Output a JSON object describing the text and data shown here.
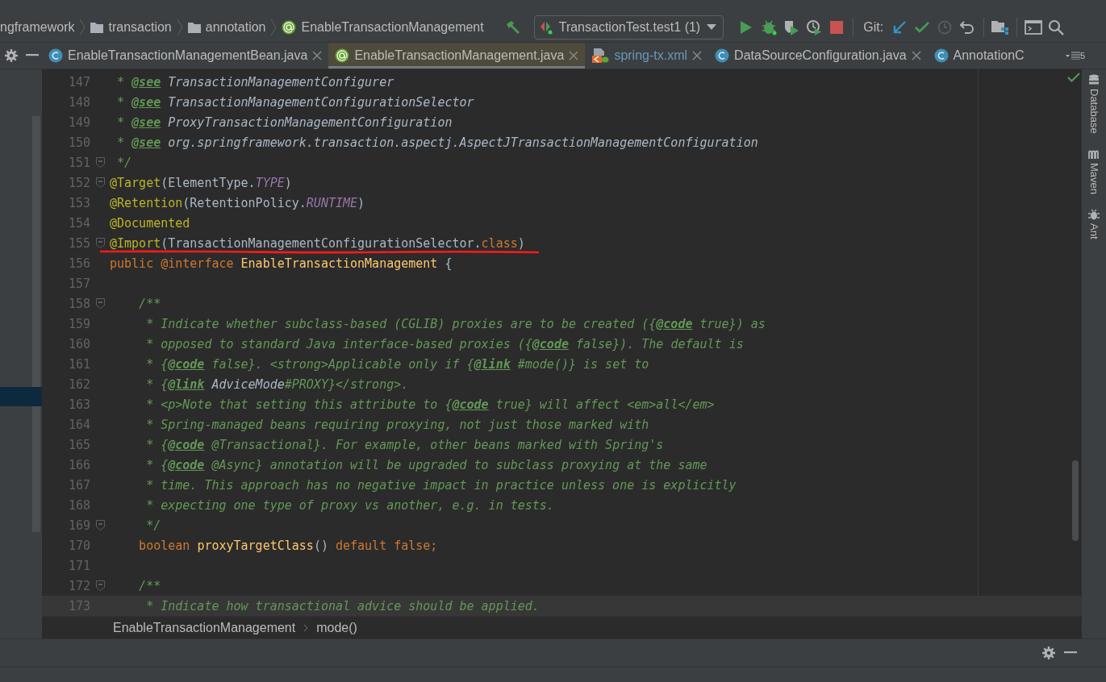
{
  "navbar": {
    "breadcrumbs": [
      {
        "label": "ngframework",
        "kind": "plain"
      },
      {
        "label": "transaction",
        "kind": "folder"
      },
      {
        "label": "annotation",
        "kind": "folder"
      },
      {
        "label": "EnableTransactionManagement",
        "kind": "annotation"
      }
    ],
    "run_config": "TransactionTest.test1 (1)",
    "git_label": "Git:"
  },
  "tabs": [
    {
      "label": "EnableTransactionManagementBean.java",
      "kind": "class",
      "selected": false,
      "closable": true
    },
    {
      "label": "EnableTransactionManagement.java",
      "kind": "annotation",
      "selected": true,
      "closable": true
    },
    {
      "label": "spring-tx.xml",
      "kind": "xml",
      "selected": false,
      "closable": true
    },
    {
      "label": "DataSourceConfiguration.java",
      "kind": "class",
      "selected": false,
      "closable": true
    },
    {
      "label": "AnnotationC",
      "kind": "class",
      "selected": false,
      "closable": false
    }
  ],
  "tab_overflow": "5",
  "side_tools": [
    "Database",
    "Maven",
    "Ant"
  ],
  "editor": {
    "lines": [
      {
        "n": "147",
        "fold": false,
        "current": false,
        "segments": [
          {
            "t": " * ",
            "kind": "doc"
          },
          {
            "t": "@see",
            "kind": "doctag"
          },
          {
            "t": " TransactionManagementConfigurer",
            "kind": "docref"
          }
        ]
      },
      {
        "n": "148",
        "fold": false,
        "current": false,
        "segments": [
          {
            "t": " * ",
            "kind": "doc"
          },
          {
            "t": "@see",
            "kind": "doctag"
          },
          {
            "t": " TransactionManagementConfigurationSelector",
            "kind": "docref"
          }
        ]
      },
      {
        "n": "149",
        "fold": false,
        "current": false,
        "segments": [
          {
            "t": " * ",
            "kind": "doc"
          },
          {
            "t": "@see",
            "kind": "doctag"
          },
          {
            "t": " ProxyTransactionManagementConfiguration",
            "kind": "docref"
          }
        ]
      },
      {
        "n": "150",
        "fold": false,
        "current": false,
        "segments": [
          {
            "t": " * ",
            "kind": "doc"
          },
          {
            "t": "@see",
            "kind": "doctag"
          },
          {
            "t": " org.springframework.transaction.aspectj.AspectJTransactionManagementConfiguration",
            "kind": "docref"
          }
        ]
      },
      {
        "n": "151",
        "fold": true,
        "current": false,
        "segments": [
          {
            "t": " */",
            "kind": "doc"
          }
        ]
      },
      {
        "n": "152",
        "fold": true,
        "current": false,
        "segments": [
          {
            "t": "@Target",
            "kind": "annotation"
          },
          {
            "t": "(ElementType.",
            "kind": "plain"
          },
          {
            "t": "TYPE",
            "kind": "const"
          },
          {
            "t": ")",
            "kind": "plain"
          }
        ]
      },
      {
        "n": "153",
        "fold": false,
        "current": false,
        "segments": [
          {
            "t": "@Retention",
            "kind": "annotation"
          },
          {
            "t": "(RetentionPolicy.",
            "kind": "plain"
          },
          {
            "t": "RUNTIME",
            "kind": "const"
          },
          {
            "t": ")",
            "kind": "plain"
          }
        ]
      },
      {
        "n": "154",
        "fold": false,
        "current": false,
        "segments": [
          {
            "t": "@Documented",
            "kind": "annotation"
          }
        ]
      },
      {
        "n": "155",
        "fold": true,
        "current": false,
        "marked": true,
        "segments": [
          {
            "t": "@Import",
            "kind": "annotation"
          },
          {
            "t": "(TransactionManagementConfigurationSelector.",
            "kind": "plain"
          },
          {
            "t": "class",
            "kind": "keyword"
          },
          {
            "t": ")",
            "kind": "plain"
          }
        ]
      },
      {
        "n": "156",
        "fold": false,
        "current": false,
        "segments": [
          {
            "t": "public @interface ",
            "kind": "keyword"
          },
          {
            "t": "EnableTransactionManagement",
            "kind": "method"
          },
          {
            "t": " {",
            "kind": "plain"
          }
        ]
      },
      {
        "n": "157",
        "fold": false,
        "current": false
      },
      {
        "n": "158",
        "fold": true,
        "current": false,
        "segments": [
          {
            "t": "    /**",
            "kind": "doc"
          }
        ]
      },
      {
        "n": "159",
        "fold": false,
        "current": false,
        "segments": [
          {
            "t": "     * Indicate whether subclass-based (CGLIB) proxies are to be created ({",
            "kind": "doc"
          },
          {
            "t": "@code",
            "kind": "doctag"
          },
          {
            "t": " true}) as",
            "kind": "doc"
          }
        ]
      },
      {
        "n": "160",
        "fold": false,
        "current": false,
        "segments": [
          {
            "t": "     * opposed to standard Java interface-based proxies ({",
            "kind": "doc"
          },
          {
            "t": "@code",
            "kind": "doctag"
          },
          {
            "t": " false}). The default is",
            "kind": "doc"
          }
        ]
      },
      {
        "n": "161",
        "fold": false,
        "current": false,
        "segments": [
          {
            "t": "     * {",
            "kind": "doc"
          },
          {
            "t": "@code",
            "kind": "doctag"
          },
          {
            "t": " false}. <strong>Applicable only if {",
            "kind": "doc"
          },
          {
            "t": "@link",
            "kind": "doctag"
          },
          {
            "t": " #mode()} is set to",
            "kind": "doc"
          }
        ]
      },
      {
        "n": "162",
        "fold": false,
        "current": false,
        "segments": [
          {
            "t": "     * {",
            "kind": "doc"
          },
          {
            "t": "@link",
            "kind": "doctag"
          },
          {
            "t": " AdviceMode",
            "kind": "docref"
          },
          {
            "t": "#PROXY}</strong>.",
            "kind": "doc"
          }
        ]
      },
      {
        "n": "163",
        "fold": false,
        "current": false,
        "segments": [
          {
            "t": "     * <p>Note that setting this attribute to {",
            "kind": "doc"
          },
          {
            "t": "@code",
            "kind": "doctag"
          },
          {
            "t": " true} will affect <em>all</em>",
            "kind": "doc"
          }
        ]
      },
      {
        "n": "164",
        "fold": false,
        "current": false,
        "segments": [
          {
            "t": "     * Spring-managed beans requiring proxying, not just those marked with",
            "kind": "doc"
          }
        ]
      },
      {
        "n": "165",
        "fold": false,
        "current": false,
        "segments": [
          {
            "t": "     * {",
            "kind": "doc"
          },
          {
            "t": "@code",
            "kind": "doctag"
          },
          {
            "t": " @Transactional}. For example, other beans marked with Spring's",
            "kind": "doc"
          }
        ]
      },
      {
        "n": "166",
        "fold": false,
        "current": false,
        "segments": [
          {
            "t": "     * {",
            "kind": "doc"
          },
          {
            "t": "@code",
            "kind": "doctag"
          },
          {
            "t": " @Async} annotation will be upgraded to subclass proxying at the same",
            "kind": "doc"
          }
        ]
      },
      {
        "n": "167",
        "fold": false,
        "current": false,
        "segments": [
          {
            "t": "     * time. This approach has no negative impact in practice unless one is explicitly",
            "kind": "doc"
          }
        ]
      },
      {
        "n": "168",
        "fold": false,
        "current": false,
        "segments": [
          {
            "t": "     * expecting one type of proxy vs another, e.g. in tests.",
            "kind": "doc"
          }
        ]
      },
      {
        "n": "169",
        "fold": true,
        "current": false,
        "segments": [
          {
            "t": "     */",
            "kind": "doc"
          }
        ]
      },
      {
        "n": "170",
        "fold": false,
        "current": false,
        "segments": [
          {
            "t": "    boolean ",
            "kind": "keyword"
          },
          {
            "t": "proxyTargetClass",
            "kind": "method"
          },
          {
            "t": "()",
            "kind": "plain"
          },
          {
            "t": " default false;",
            "kind": "keyword"
          }
        ]
      },
      {
        "n": "171",
        "fold": false,
        "current": false
      },
      {
        "n": "172",
        "fold": true,
        "current": false,
        "segments": [
          {
            "t": "    /**",
            "kind": "doc"
          }
        ]
      },
      {
        "n": "173",
        "fold": false,
        "current": true,
        "segments": [
          {
            "t": "     * Indicate how transactional advice should be applied.",
            "kind": "doc"
          }
        ]
      }
    ],
    "breadcrumbs": [
      "EnableTransactionManagement",
      "mode()"
    ]
  }
}
